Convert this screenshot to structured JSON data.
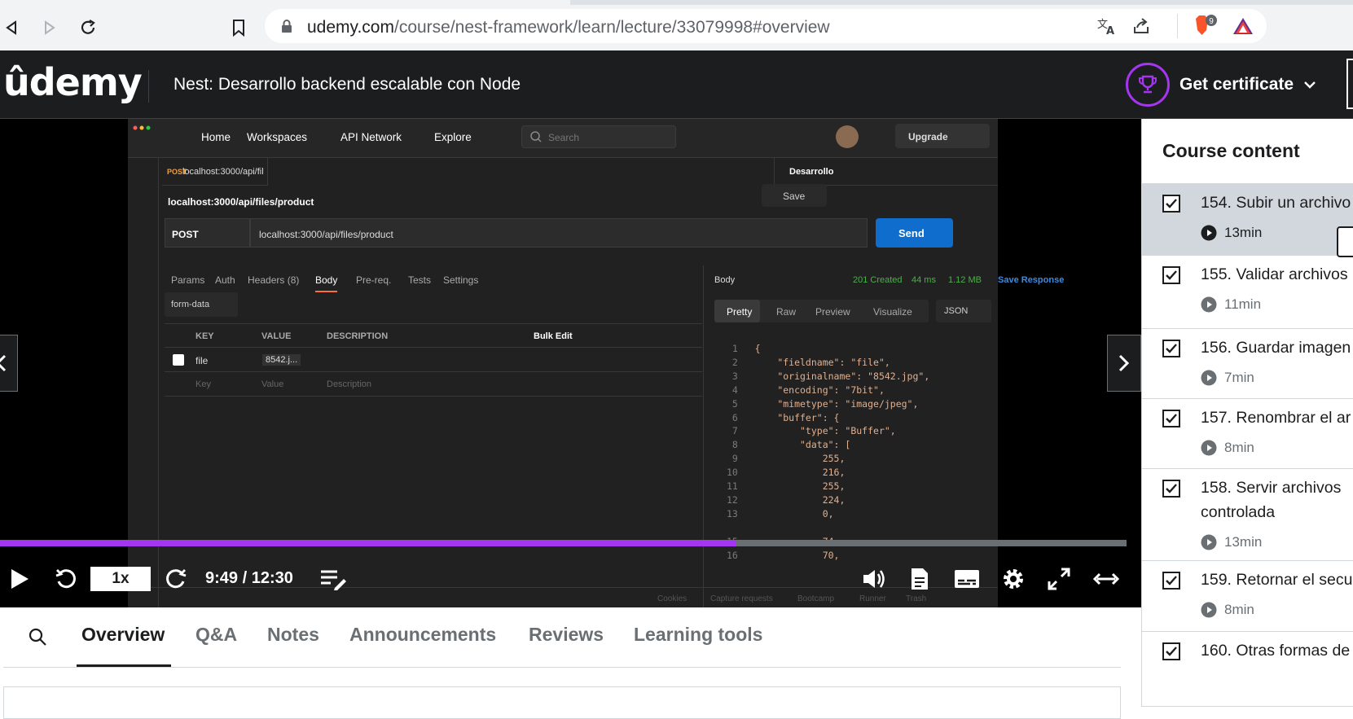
{
  "browser": {
    "url_host": "udemy.com",
    "url_path": "/course/nest-framework/learn/lecture/33079998#overview",
    "brave_badge": "9"
  },
  "header": {
    "logo": "ûdemy",
    "course_title": "Nest: Desarrollo backend escalable con Node",
    "certificate_label": "Get certificate"
  },
  "postman": {
    "nav": [
      "Home",
      "Workspaces",
      "API Network",
      "Explore"
    ],
    "search_placeholder": "Search",
    "upgrade": "Upgrade",
    "tab_method": "POST",
    "tab_url": "localhost:3000/api/fil",
    "environment": "Desarrollo",
    "request_name": "localhost:3000/api/files/product",
    "save": "Save",
    "method": "POST",
    "request_url": "localhost:3000/api/files/product",
    "send": "Send",
    "req_tabs": [
      "Params",
      "Auth",
      "Headers (8)",
      "Body",
      "Pre-req.",
      "Tests",
      "Settings"
    ],
    "body_type": "form-data",
    "table_headers": [
      "KEY",
      "VALUE",
      "DESCRIPTION"
    ],
    "bulk_edit": "Bulk Edit",
    "row_key": "file",
    "row_value": "8542.j...",
    "placeholder_key": "Key",
    "placeholder_value": "Value",
    "placeholder_desc": "Description",
    "resp_label": "Body",
    "status": "201 Created",
    "time": "44 ms",
    "size": "1.12 MB",
    "save_response": "Save Response",
    "resp_tabs": [
      "Pretty",
      "Raw",
      "Preview",
      "Visualize"
    ],
    "format": "JSON",
    "footer": [
      "Cookies",
      "Capture requests",
      "Bootcamp",
      "Runner",
      "Trash"
    ],
    "code_lines": [
      {
        "n": "1",
        "t": "{"
      },
      {
        "n": "2",
        "t": "    \"fieldname\": \"file\","
      },
      {
        "n": "3",
        "t": "    \"originalname\": \"8542.jpg\","
      },
      {
        "n": "4",
        "t": "    \"encoding\": \"7bit\","
      },
      {
        "n": "5",
        "t": "    \"mimetype\": \"image/jpeg\","
      },
      {
        "n": "6",
        "t": "    \"buffer\": {"
      },
      {
        "n": "7",
        "t": "        \"type\": \"Buffer\","
      },
      {
        "n": "8",
        "t": "        \"data\": ["
      },
      {
        "n": "9",
        "t": "            255,"
      },
      {
        "n": "10",
        "t": "            216,"
      },
      {
        "n": "11",
        "t": "            255,"
      },
      {
        "n": "12",
        "t": "            224,"
      },
      {
        "n": "13",
        "t": "            0,"
      },
      {
        "n": "15",
        "t": "            74,"
      },
      {
        "n": "16",
        "t": "            70,"
      }
    ]
  },
  "player": {
    "speed": "1x",
    "time": "9:49 / 12:30",
    "progress": 0.654
  },
  "tabs": [
    "Overview",
    "Q&A",
    "Notes",
    "Announcements",
    "Reviews",
    "Learning tools"
  ],
  "sidebar": {
    "title": "Course content",
    "items": [
      {
        "title": "154. Subir un archivo",
        "duration": "13min"
      },
      {
        "title": "155. Validar archivos",
        "duration": "11min"
      },
      {
        "title": "156. Guardar imagen",
        "duration": "7min"
      },
      {
        "title": "157. Renombrar el ar",
        "duration": "8min"
      },
      {
        "title": "158. Servir archivos",
        "title2": "controlada",
        "duration": "13min"
      },
      {
        "title": "159. Retornar el secu",
        "duration": "8min"
      },
      {
        "title": "160. Otras formas de",
        "duration": ""
      }
    ]
  },
  "colors": {
    "accent": "#a435f0",
    "send": "#0f6ecd",
    "status_ok": "#4db04a"
  }
}
